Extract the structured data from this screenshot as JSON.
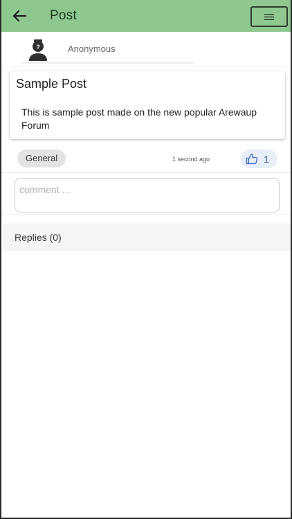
{
  "appbar": {
    "title": "Post",
    "back_icon": "arrow-left-icon",
    "menu_icon": "hamburger-menu-icon",
    "color": "#8ec88e"
  },
  "author": {
    "name": "Anonymous",
    "avatar_icon": "anonymous-user-avatar-icon"
  },
  "post": {
    "title": "Sample Post",
    "body": "This is sample post made on the new popular Arewaup Forum"
  },
  "meta": {
    "category": "General",
    "timestamp": "1 second ago",
    "like_icon": "thumbs-up-icon",
    "like_count": "1"
  },
  "comment": {
    "placeholder": "comment ...",
    "value": ""
  },
  "replies": {
    "label": "Replies (0)"
  }
}
